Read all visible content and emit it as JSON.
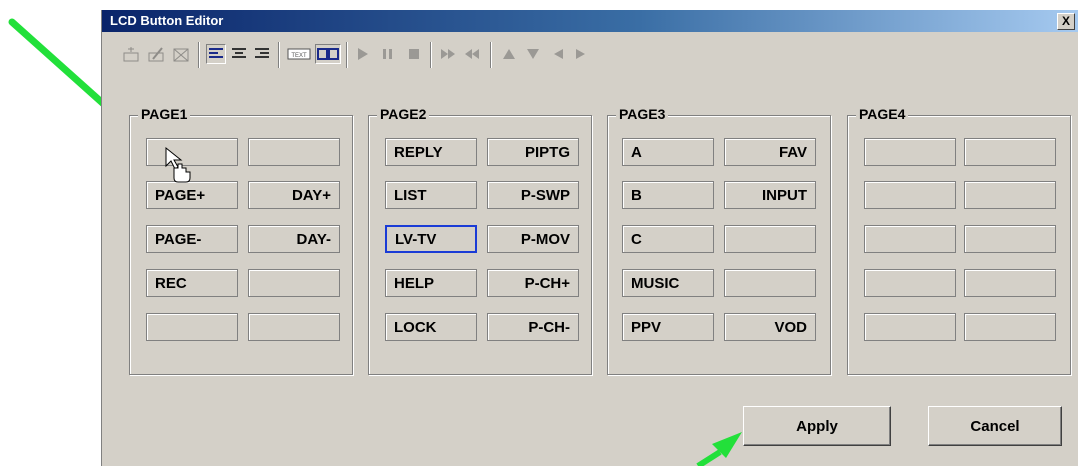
{
  "window": {
    "title": "LCD Button Editor",
    "close_label": "X"
  },
  "toolbar": {
    "buttons": [
      {
        "icon": "new-doc-icon"
      },
      {
        "icon": "edit-icon"
      },
      {
        "icon": "delete-icon"
      },
      {
        "icon": "align-left-icon"
      },
      {
        "icon": "align-center-icon"
      },
      {
        "icon": "align-right-icon"
      },
      {
        "icon": "text-mode-icon",
        "label": "TEXT"
      },
      {
        "icon": "double-box-icon"
      },
      {
        "icon": "play-icon"
      },
      {
        "icon": "pause-icon"
      },
      {
        "icon": "stop-icon"
      },
      {
        "icon": "fast-forward-icon"
      },
      {
        "icon": "rewind-icon"
      },
      {
        "icon": "up-arrow-icon"
      },
      {
        "icon": "down-arrow-icon"
      },
      {
        "icon": "left-arrow-icon"
      },
      {
        "icon": "right-arrow-icon"
      }
    ]
  },
  "pages": [
    {
      "name": "PAGE1",
      "buttons": [
        [
          "",
          ""
        ],
        [
          "PAGE+",
          "DAY+"
        ],
        [
          "PAGE-",
          "DAY-"
        ],
        [
          "REC",
          ""
        ],
        [
          "",
          ""
        ]
      ]
    },
    {
      "name": "PAGE2",
      "buttons": [
        [
          "REPLY",
          "PIPTG"
        ],
        [
          "LIST",
          "P-SWP"
        ],
        [
          "LV-TV",
          "P-MOV"
        ],
        [
          "HELP",
          "P-CH+"
        ],
        [
          "LOCK",
          "P-CH-"
        ]
      ]
    },
    {
      "name": "PAGE3",
      "buttons": [
        [
          "A",
          "FAV"
        ],
        [
          "B",
          "INPUT"
        ],
        [
          "C",
          ""
        ],
        [
          "MUSIC",
          ""
        ],
        [
          "PPV",
          "VOD"
        ]
      ]
    },
    {
      "name": "PAGE4",
      "buttons": [
        [
          "",
          ""
        ],
        [
          "",
          ""
        ],
        [
          "",
          ""
        ],
        [
          "",
          ""
        ],
        [
          "",
          ""
        ]
      ]
    }
  ],
  "actions": {
    "apply_label": "Apply",
    "cancel_label": "Cancel"
  },
  "colors": {
    "title_bar": "#0a246a",
    "annotation_arrow": "#22e03a",
    "selection_border": "#1a3bd6"
  }
}
